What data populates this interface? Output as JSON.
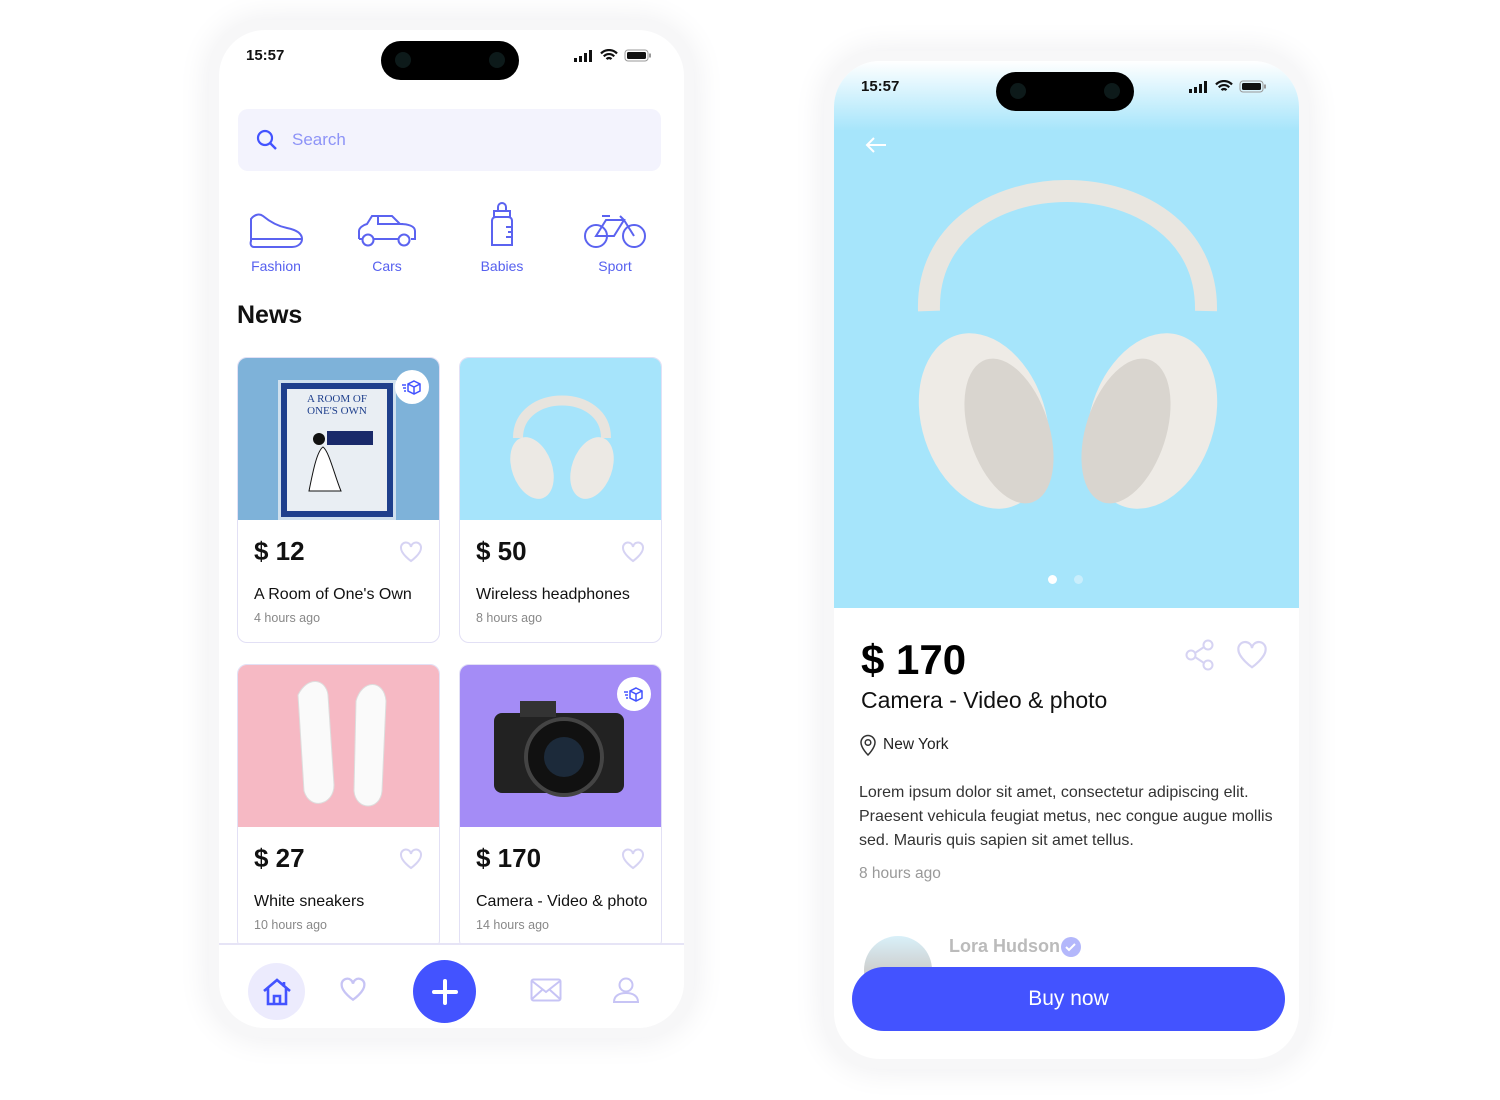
{
  "colors": {
    "accent": "#4353ff",
    "icon": "#5b63f0",
    "muted_icon": "#c7c4f5"
  },
  "list_screen": {
    "status": {
      "time": "15:57"
    },
    "search": {
      "placeholder": "Search",
      "icon": "search-icon"
    },
    "categories": [
      {
        "label": "Fashion",
        "icon": "sneaker-icon"
      },
      {
        "label": "Cars",
        "icon": "car-icon"
      },
      {
        "label": "Babies",
        "icon": "baby-bottle-icon"
      },
      {
        "label": "Sport",
        "icon": "bicycle-icon"
      }
    ],
    "section_title": "News",
    "items": [
      {
        "price": "$ 12",
        "title": "A Room of One's Own",
        "time": "4 hours ago",
        "image_bg": "#7eb2d9",
        "cover_text": "A ROOM OF ONE'S OWN",
        "badge": true
      },
      {
        "price": "$ 50",
        "title": "Wireless headphones",
        "time": "8 hours ago",
        "image_bg": "#a6e4fb",
        "badge": false
      },
      {
        "price": "$ 27",
        "title": "White sneakers",
        "time": "10 hours ago",
        "image_bg": "#f6b9c4",
        "badge": false
      },
      {
        "price": "$ 170",
        "title": "Camera - Video & photo",
        "time": "14 hours ago",
        "image_bg": "#a48cf6",
        "badge": true
      }
    ],
    "nav": [
      {
        "icon": "home-icon",
        "active": true
      },
      {
        "icon": "heart-icon"
      },
      {
        "icon": "plus-icon"
      },
      {
        "icon": "mail-icon"
      },
      {
        "icon": "user-icon"
      }
    ]
  },
  "detail_screen": {
    "status": {
      "time": "15:57"
    },
    "carousel": {
      "pages": 2,
      "current": 1
    },
    "price": "$ 170",
    "title": "Camera - Video & photo",
    "location": "New York",
    "description": "Lorem ipsum dolor sit amet, consectetur adipiscing elit. Praesent vehicula feugiat metus, nec congue augue mollis sed. Mauris quis sapien sit amet tellus.",
    "time": "8 hours ago",
    "seller": {
      "name": "Lora Hudson",
      "verified": true
    },
    "buy_label": "Buy now"
  }
}
